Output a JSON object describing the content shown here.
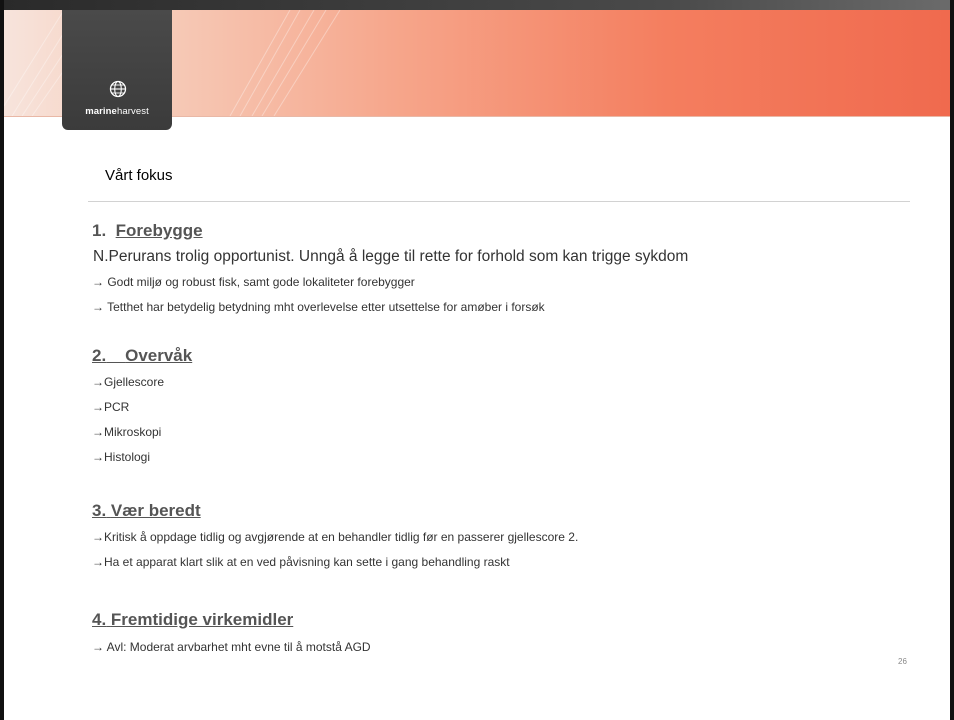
{
  "logo": {
    "brand_bold": "marine",
    "brand_regular": "harvest"
  },
  "slide": {
    "heading": "Vårt fokus",
    "page_number": "26"
  },
  "sections": [
    {
      "number": "1.",
      "title": "Forebygge",
      "lead": "N.Perurans trolig opportunist. Unngå å legge til rette for forhold som kan trigge sykdom",
      "bullets": [
        "→ Godt miljø og robust fisk, samt gode lokaliteter forebygger",
        "→ Tetthet har betydelig betydning mht overlevelse etter utsettelse for amøber i forsøk"
      ]
    },
    {
      "number": "2.",
      "title": "Overvåk",
      "bullets": [
        "→Gjellescore",
        "→PCR",
        "→Mikroskopi",
        "→Histologi"
      ]
    },
    {
      "number": "3.",
      "title": "Vær beredt",
      "bullets": [
        "→Kritisk å oppdage tidlig og avgjørende at en behandler tidlig før en passerer gjellescore 2.",
        "→Ha et apparat klart slik at en ved påvisning kan sette i gang behandling raskt"
      ]
    },
    {
      "number": "4.",
      "title": "Fremtidige virkemidler",
      "bullets": [
        "→ Avl: Moderat arvbarhet mht evne til å motstå AGD"
      ]
    }
  ]
}
